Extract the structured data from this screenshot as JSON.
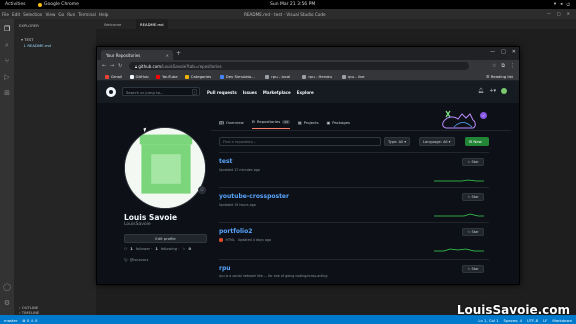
{
  "system": {
    "activities": "Activities",
    "app": "Google Chrome",
    "clock": "Sun Mar 21  3:56 PM"
  },
  "vscode": {
    "title": "README.md - test - Visual Studio Code",
    "menu": [
      "File",
      "Edit",
      "Selection",
      "View",
      "Go",
      "Run",
      "Terminal",
      "Help"
    ],
    "explorer_header": "EXPLORER",
    "folder": "TEST",
    "file": "README.md",
    "tabs": [
      "Welcome",
      "README.md"
    ],
    "outline": "OUTLINE",
    "timeline": "TIMELINE",
    "status_left": [
      "master",
      "⊗ 0 ⚠ 0"
    ],
    "status_right": [
      "Ln 1, Col 1",
      "Spaces: 4",
      "UTF-8",
      "LF",
      "Markdown"
    ]
  },
  "chrome": {
    "tab_title": "Your Repositories",
    "url_host": "github.com",
    "url_path": "/LouisSavoie?tab=repositories",
    "bookmarks": [
      {
        "label": "Gmail",
        "color": "#ea4335"
      },
      {
        "label": "GitHub",
        "color": "#f0f6fc"
      },
      {
        "label": "YouTube",
        "color": "#ff0000"
      },
      {
        "label": "Categories",
        "color": "#f4b400"
      },
      {
        "label": "Dev Simulato...",
        "color": "#4285f4"
      },
      {
        "label": "rpu - local",
        "color": "#9aa0a6"
      },
      {
        "label": "rpu - Heroku",
        "color": "#9aa0a6"
      },
      {
        "label": "rpu - live",
        "color": "#9aa0a6"
      }
    ],
    "reading_list": "Reading list"
  },
  "github": {
    "search_placeholder": "Search or jump to...",
    "search_key": "/",
    "nav": [
      "Pull requests",
      "Issues",
      "Marketplace",
      "Explore"
    ],
    "profile": {
      "name": "Louis Savoie",
      "username": "LouisSavoie",
      "edit_button": "Edit profile",
      "followers": "1",
      "followers_label": "follower ·",
      "following": "1",
      "following_label": "following ·",
      "stars": "0",
      "twitter": "@lsnavarz"
    },
    "tabs": [
      {
        "label": "Overview",
        "icon": "book-icon"
      },
      {
        "label": "Repositories",
        "count": "23",
        "icon": "repo-icon"
      },
      {
        "label": "Projects",
        "icon": "project-icon"
      },
      {
        "label": "Packages",
        "icon": "package-icon"
      }
    ],
    "find_placeholder": "Find a repository...",
    "type_filter": "Type: All ▾",
    "language_filter": "Language: All ▾",
    "new_button": "New",
    "repos": [
      {
        "name": "test",
        "updated": "Updated 17 minutes ago",
        "language": "",
        "lang_color": "",
        "description": "",
        "star": "Star"
      },
      {
        "name": "youtube-crossposter",
        "updated": "Updated 19 hours ago",
        "language": "",
        "lang_color": "",
        "description": "",
        "star": "Star"
      },
      {
        "name": "portfolio2",
        "updated": "Updated 4 days ago",
        "language": "HTML",
        "lang_color": "#e34c26",
        "description": "",
        "star": "Star"
      },
      {
        "name": "rpu",
        "updated": "",
        "language": "",
        "lang_color": "",
        "description": "rpu is a social network like ... for one of going coding/cross-acting",
        "star": "Star"
      }
    ]
  },
  "watermark": "LouisSavoie.com"
}
